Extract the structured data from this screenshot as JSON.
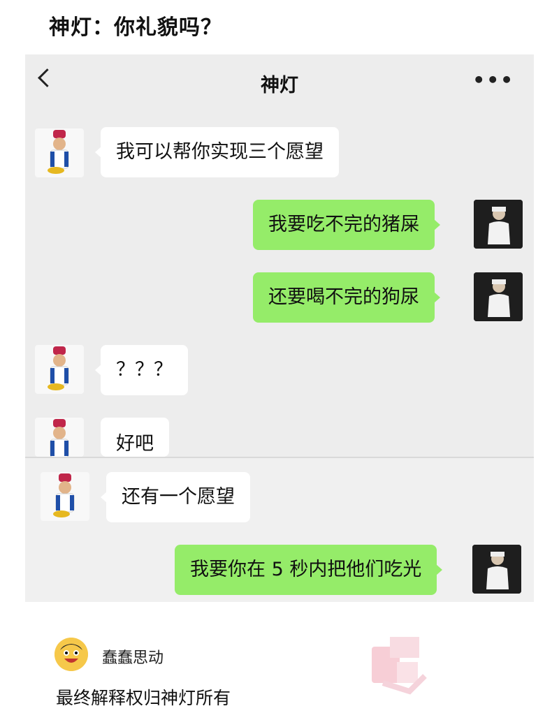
{
  "post": {
    "title": "神灯：你礼貌吗？"
  },
  "chat": {
    "title": "神灯",
    "back_icon": "chevron-left-icon",
    "more_label": "•••",
    "messages": [
      {
        "side": "left",
        "sender": "genie",
        "text": "我可以帮你实现三个愿望"
      },
      {
        "side": "right",
        "sender": "user",
        "text": "我要吃不完的猪屎"
      },
      {
        "side": "right",
        "sender": "user",
        "text": "还要喝不完的狗尿"
      },
      {
        "side": "left",
        "sender": "genie",
        "text": "？？？"
      },
      {
        "side": "left",
        "sender": "genie",
        "text": "好吧"
      },
      {
        "side": "left",
        "sender": "genie",
        "text": "还有一个愿望"
      },
      {
        "side": "right",
        "sender": "user",
        "text": "我要你在 5 秒内把他们吃光"
      }
    ],
    "colors": {
      "sent_bubble": "#95ec69",
      "received_bubble": "#ffffff",
      "background": "#ededed"
    }
  },
  "comment": {
    "username": "蠢蠢思动",
    "text": "最终解释权归神灯所有"
  }
}
